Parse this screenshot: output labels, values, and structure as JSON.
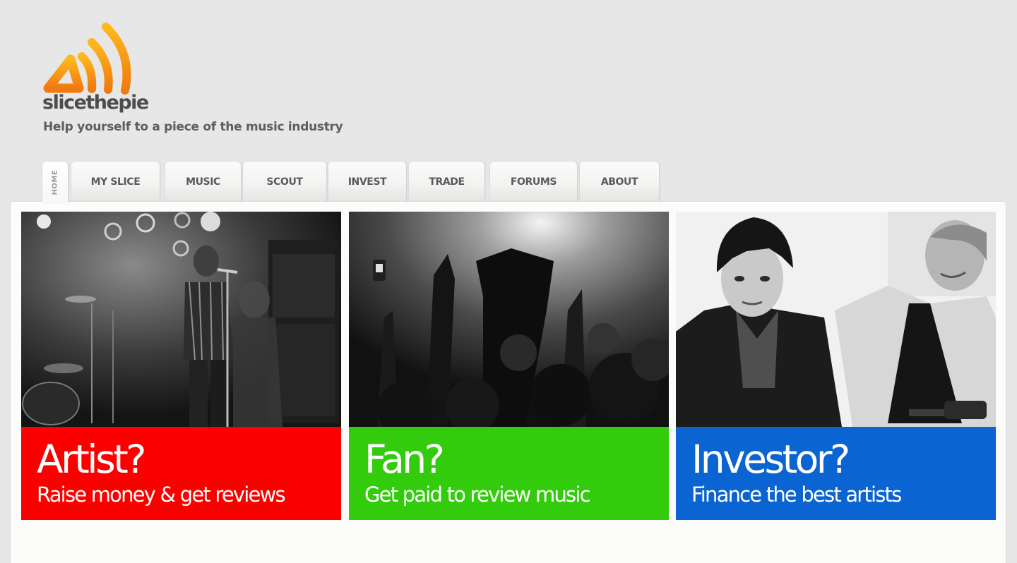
{
  "brand": {
    "name": "slicethepie",
    "tagline": "Help yourself to a piece of the music industry",
    "logo_colors": [
      "#ffb81c",
      "#f07a10"
    ]
  },
  "nav": {
    "home_label": "HOME",
    "items": [
      {
        "label": "MY SLICE"
      },
      {
        "label": "MUSIC"
      },
      {
        "label": "SCOUT"
      },
      {
        "label": "INVEST"
      },
      {
        "label": "TRADE"
      },
      {
        "label": "FORUMS"
      },
      {
        "label": "ABOUT"
      }
    ]
  },
  "cards": [
    {
      "title": "Artist?",
      "subtitle": "Raise money & get reviews",
      "color": "#fc0000",
      "image": "band-on-stage-photo"
    },
    {
      "title": "Fan?",
      "subtitle": "Get paid to review music",
      "color": "#33cc0d",
      "image": "concert-crowd-photo"
    },
    {
      "title": "Investor?",
      "subtitle": "Finance the best artists",
      "color": "#0a64d2",
      "image": "two-men-portrait-photo"
    }
  ]
}
